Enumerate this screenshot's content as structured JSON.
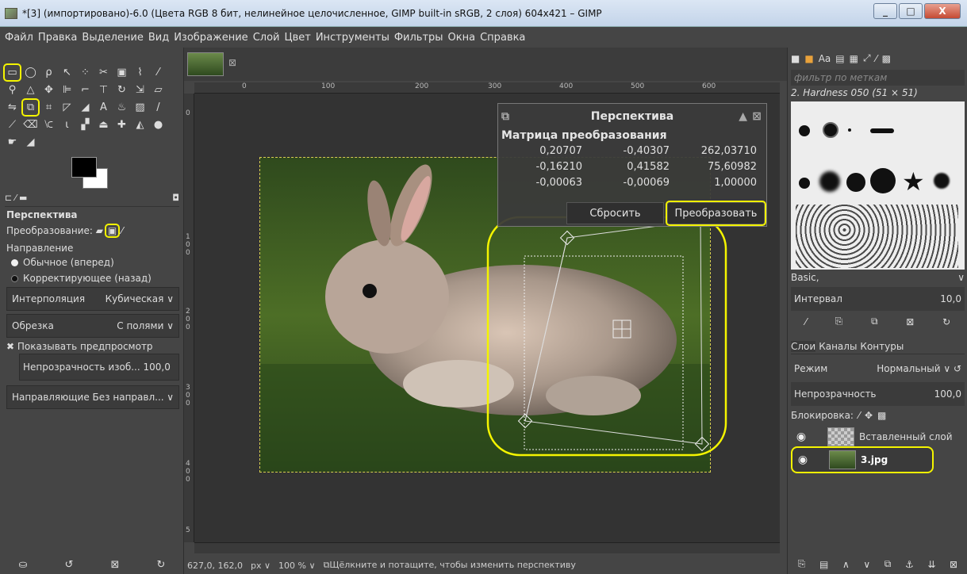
{
  "window": {
    "title": "*[3] (импортировано)-6.0 (Цвета RGB 8 бит, нелинейное целочисленное, GIMP built-in sRGB, 2 слоя) 604x421 – GIMP"
  },
  "menu": [
    "Файл",
    "Правка",
    "Выделение",
    "Вид",
    "Изображение",
    "Слой",
    "Цвет",
    "Инструменты",
    "Фильтры",
    "Окна",
    "Справка"
  ],
  "tool_options": {
    "title": "Перспектива",
    "transform_label": "Преобразование:",
    "direction_label": "Направление",
    "direction_forward": "Обычное (вперед)",
    "direction_backward": "Корректирующее (назад)",
    "interpolation_label": "Интерполяция",
    "interpolation_value": "Кубическая",
    "clipping_label": "Обрезка",
    "clipping_value": "С полями",
    "show_preview": "Показывать предпросмотр",
    "opacity_label": "Непрозрачность изоб...",
    "opacity_value": "100,0",
    "guides": "Направляющие Без направл..."
  },
  "ruler_h": [
    "0",
    "100",
    "200",
    "300",
    "400",
    "500",
    "600"
  ],
  "ruler_v": [
    "0",
    "1 0 0",
    "2 0 0",
    "3 0 0",
    "4 0 0",
    "5"
  ],
  "dialog": {
    "title": "Перспектива",
    "subtitle": "Матрица преобразования",
    "matrix": [
      [
        "0,20707",
        "-0,40307",
        "262,03710"
      ],
      [
        "-0,16210",
        "0,41582",
        "75,60982"
      ],
      [
        "-0,00063",
        "-0,00069",
        "1,00000"
      ]
    ],
    "reset": "Сбросить",
    "apply": "Преобразовать"
  },
  "status": {
    "coords": "627,0, 162,0",
    "unit": "px",
    "zoom": "100 %",
    "hint": "Щёлкните и потащите, чтобы изменить перспективу"
  },
  "dock": {
    "filter_placeholder": "фильтр по меткам",
    "brush_name": "2. Hardness 050 (51 × 51)",
    "preset": "Basic,",
    "spacing_label": "Интервал",
    "spacing_value": "10,0",
    "tabs": [
      "Слои",
      "Каналы",
      "Контуры"
    ],
    "mode_label": "Режим",
    "mode_value": "Нормальный",
    "opacity_label": "Непрозрачность",
    "opacity_value": "100,0",
    "lock_label": "Блокировка:",
    "layers": [
      "Вставленный слой",
      "3.jpg"
    ]
  },
  "colors": {
    "highlight": "#f4f400"
  }
}
